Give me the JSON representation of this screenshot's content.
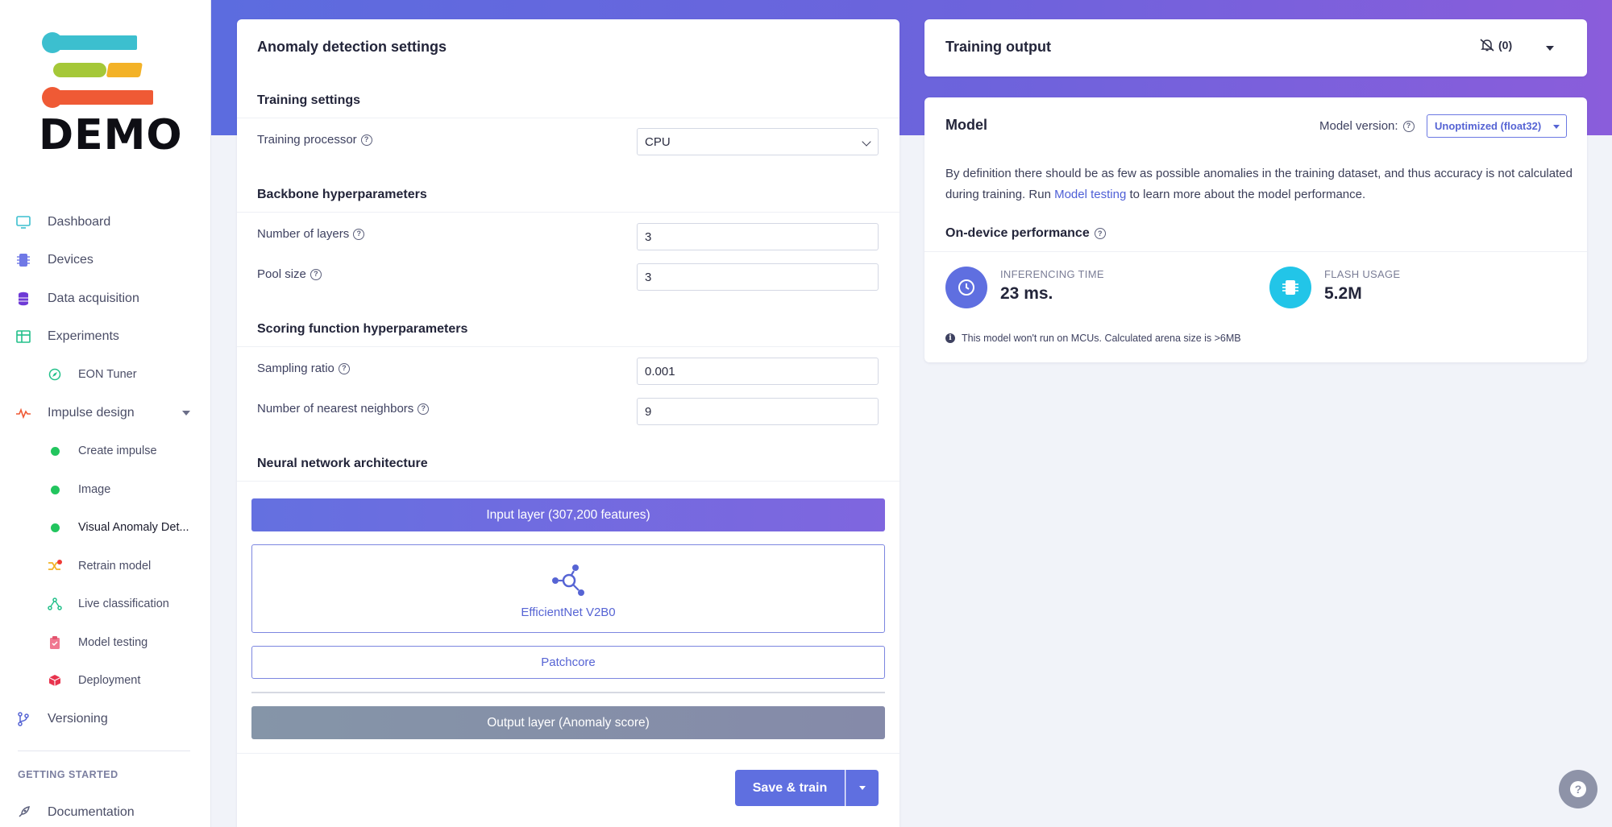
{
  "logo": {
    "text": "DEMO"
  },
  "sidebar": {
    "items": [
      {
        "label": "Dashboard",
        "icon": "monitor-icon"
      },
      {
        "label": "Devices",
        "icon": "chip-icon"
      },
      {
        "label": "Data acquisition",
        "icon": "database-icon"
      },
      {
        "label": "Experiments",
        "icon": "table-icon"
      },
      {
        "label": "EON Tuner",
        "icon": "compass-icon"
      },
      {
        "label": "Impulse design",
        "icon": "pulse-icon"
      },
      {
        "label": "Create impulse",
        "icon": "status-dot-icon"
      },
      {
        "label": "Image",
        "icon": "status-dot-icon"
      },
      {
        "label": "Visual Anomaly Det...",
        "icon": "status-dot-icon"
      },
      {
        "label": "Retrain model",
        "icon": "shuffle-icon"
      },
      {
        "label": "Live classification",
        "icon": "network-icon"
      },
      {
        "label": "Model testing",
        "icon": "clipboard-check-icon"
      },
      {
        "label": "Deployment",
        "icon": "cube-icon"
      },
      {
        "label": "Versioning",
        "icon": "branch-icon"
      }
    ],
    "section_label": "GETTING STARTED",
    "documentation": "Documentation"
  },
  "settings": {
    "title": "Anomaly detection settings",
    "training_settings": "Training settings",
    "training_processor_label": "Training processor",
    "training_processor_value": "CPU",
    "backbone_title": "Backbone hyperparameters",
    "num_layers_label": "Number of layers",
    "num_layers_value": "3",
    "pool_size_label": "Pool size",
    "pool_size_value": "3",
    "scoring_title": "Scoring function hyperparameters",
    "sampling_ratio_label": "Sampling ratio",
    "sampling_ratio_value": "0.001",
    "nearest_label": "Number of nearest neighbors",
    "nearest_value": "9",
    "nn_title": "Neural network architecture",
    "input_layer": "Input layer (307,200 features)",
    "backbone_block": "EfficientNet V2B0",
    "patchcore_block": "Patchcore",
    "output_layer": "Output layer (Anomaly score)",
    "save_button": "Save & train"
  },
  "training_output": {
    "title": "Training output",
    "mute_count": "(0)"
  },
  "model": {
    "title": "Model",
    "version_label": "Model version:",
    "version_value": "Unoptimized (float32)",
    "desc_part1": "By definition there should be as few as possible anomalies in the training dataset, and thus accuracy is not calculated during training. Run ",
    "desc_link": "Model testing",
    "desc_part2": " to learn more about the model performance.",
    "perf_title": "On-device performance",
    "inferencing_caption": "INFERENCING TIME",
    "inferencing_value": "23 ms.",
    "flash_caption": "FLASH USAGE",
    "flash_value": "5.2M",
    "note": "This model won't run on MCUs. Calculated arena size is >6MB"
  },
  "colors": {
    "accent": "#5f6fe0",
    "header_gradient_start": "#5c6cdf",
    "header_gradient_end": "#8a5ddb",
    "status_dot": "#22c55e",
    "flash_icon_bg": "#22c5e8"
  }
}
